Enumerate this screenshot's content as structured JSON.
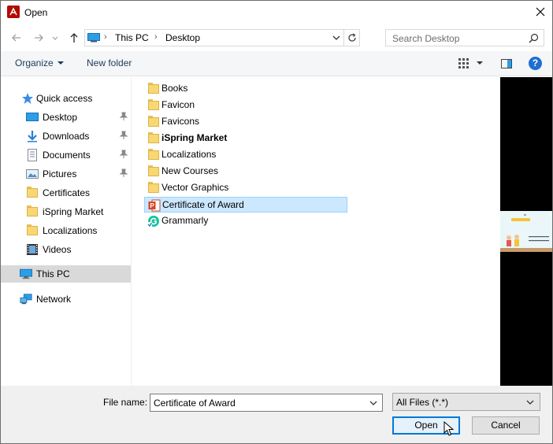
{
  "window": {
    "title": "Open"
  },
  "address": {
    "segments": [
      "This PC",
      "Desktop"
    ],
    "separator": "›"
  },
  "search": {
    "placeholder": "Search Desktop"
  },
  "toolbar": {
    "organize_label": "Organize",
    "new_folder_label": "New folder",
    "help_label": "?"
  },
  "navpane": {
    "items": [
      {
        "label": "Quick access",
        "icon": "star-icon"
      },
      {
        "label": "Desktop",
        "icon": "desktop-icon",
        "pinned": true
      },
      {
        "label": "Downloads",
        "icon": "download-icon",
        "pinned": true
      },
      {
        "label": "Documents",
        "icon": "documents-icon",
        "pinned": true
      },
      {
        "label": "Pictures",
        "icon": "pictures-icon",
        "pinned": true
      },
      {
        "label": "Certificates",
        "icon": "folder-icon"
      },
      {
        "label": "iSpring Market",
        "icon": "folder-icon"
      },
      {
        "label": "Localizations",
        "icon": "folder-icon"
      },
      {
        "label": "Videos",
        "icon": "videos-icon"
      },
      {
        "label": "This PC",
        "icon": "computer-icon",
        "selected": true
      },
      {
        "label": "Network",
        "icon": "network-icon"
      }
    ]
  },
  "files": [
    {
      "label": "Books",
      "icon": "folder-icon"
    },
    {
      "label": "Favicon",
      "icon": "folder-icon"
    },
    {
      "label": "Favicons",
      "icon": "folder-icon"
    },
    {
      "label": "iSpring Market",
      "icon": "folder-icon"
    },
    {
      "label": "Localizations",
      "icon": "folder-icon"
    },
    {
      "label": "New Courses",
      "icon": "folder-icon"
    },
    {
      "label": "Vector Graphics",
      "icon": "folder-icon"
    },
    {
      "label": "Certificate of Award",
      "icon": "powerpoint-icon",
      "selected": true
    },
    {
      "label": "Grammarly",
      "icon": "grammarly-icon"
    }
  ],
  "bottom": {
    "file_name_label": "File name:",
    "file_name_value": "Certificate of Award",
    "filter_value": "All Files (*.*)",
    "open_label": "Open",
    "cancel_label": "Cancel"
  },
  "colors": {
    "accent": "#0078d7",
    "selection": "#cce8ff",
    "folder": "#f8d775"
  }
}
